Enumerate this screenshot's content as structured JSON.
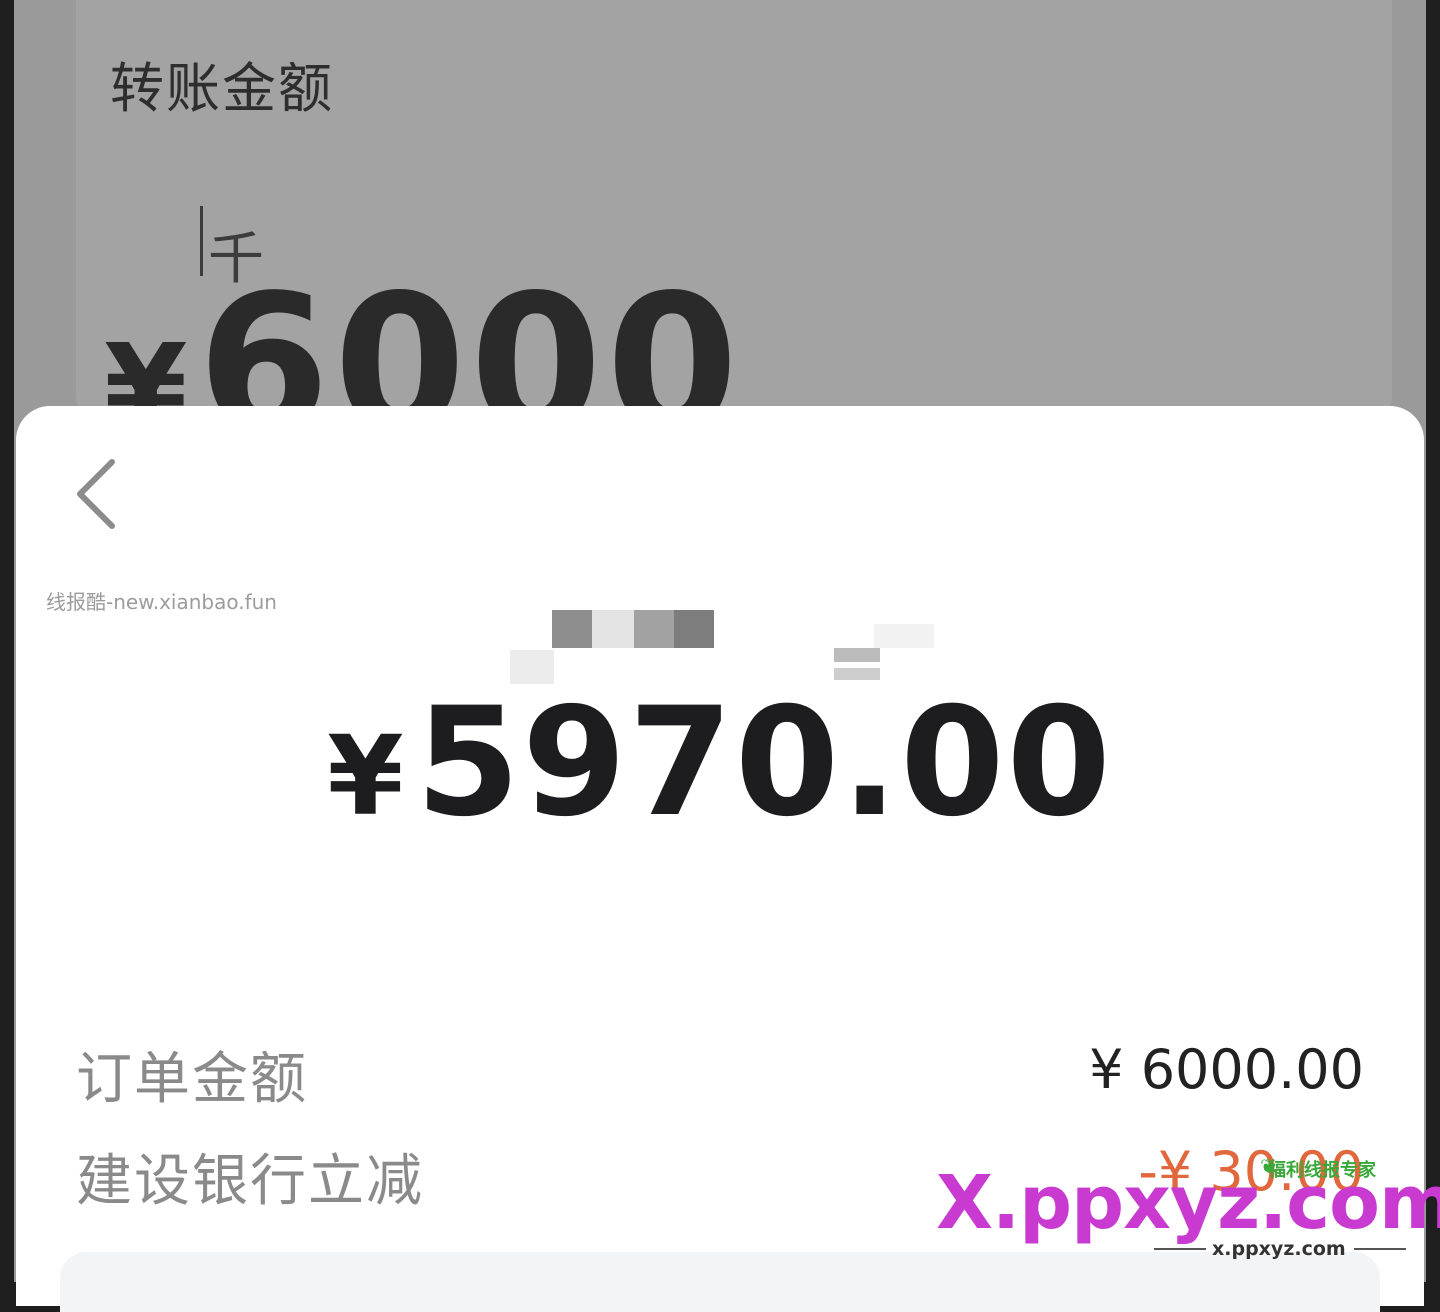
{
  "background": {
    "title": "转账金额",
    "unit_hint": "千",
    "currency_symbol": "¥",
    "amount": "6000"
  },
  "sheet": {
    "back_icon": "chevron-left-icon",
    "watermark_left": "线报酷-new.xianbao.fun",
    "payment": {
      "currency_symbol": "¥",
      "amount": "5970.00"
    },
    "details": [
      {
        "label": "订单金额",
        "value": "¥ 6000.00"
      },
      {
        "label": "建设银行立减",
        "value": "-¥ 30.00"
      }
    ]
  },
  "watermark": {
    "small_text": "福利线报专家",
    "brand": "X.ppxyz.com",
    "url": "x.ppxyz.com",
    "brand_color": "#c93bd0",
    "leaf_color": "#39a83a"
  },
  "colors": {
    "overlay": "#9a9a9a",
    "sheet": "#ffffff",
    "amount_text": "#1d1d1f",
    "label_text": "#8a8a8a",
    "discount_text": "#e0683c"
  }
}
